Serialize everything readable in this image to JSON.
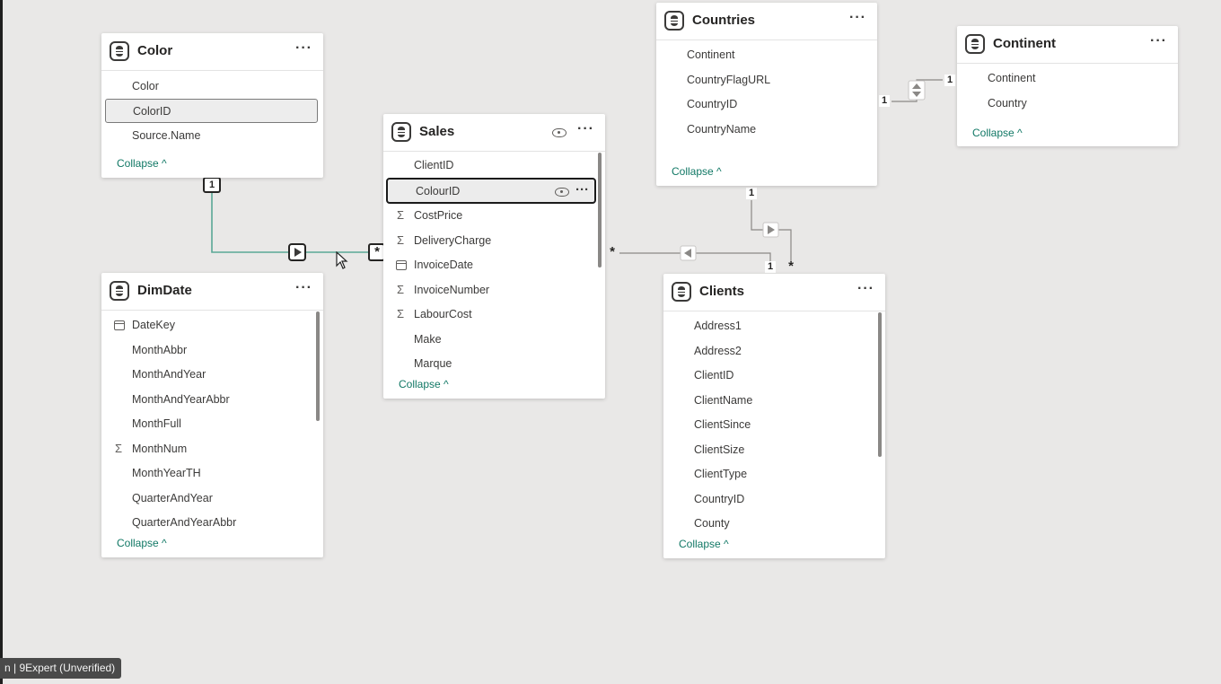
{
  "tables": {
    "color": {
      "title": "Color",
      "fields": [
        "Color",
        "ColorID",
        "Source.Name"
      ],
      "collapse": "Collapse"
    },
    "sales": {
      "title": "Sales",
      "fields": [
        "ClientID",
        "ColourID",
        "CostPrice",
        "DeliveryCharge",
        "InvoiceDate",
        "InvoiceNumber",
        "LabourCost",
        "Make",
        "Marque"
      ],
      "collapse": "Collapse"
    },
    "dimdate": {
      "title": "DimDate",
      "fields": [
        "DateKey",
        "MonthAbbr",
        "MonthAndYear",
        "MonthAndYearAbbr",
        "MonthFull",
        "MonthNum",
        "MonthYearTH",
        "QuarterAndYear",
        "QuarterAndYearAbbr"
      ],
      "collapse": "Collapse"
    },
    "countries": {
      "title": "Countries",
      "fields": [
        "Continent",
        "CountryFlagURL",
        "CountryID",
        "CountryName"
      ],
      "collapse": "Collapse"
    },
    "continent": {
      "title": "Continent",
      "fields": [
        "Continent",
        "Country"
      ],
      "collapse": "Collapse"
    },
    "clients": {
      "title": "Clients",
      "fields": [
        "Address1",
        "Address2",
        "ClientID",
        "ClientName",
        "ClientSince",
        "ClientSize",
        "ClientType",
        "CountryID",
        "County"
      ],
      "collapse": "Collapse"
    }
  },
  "cardinality": {
    "one": "1",
    "many": "*"
  },
  "more_glyph": "···",
  "collapse_glyph": "^",
  "sigma_glyph": "Σ",
  "watermark": "n | 9Expert (Unverified)",
  "colors": {
    "canvas": "#e9e8e7",
    "accent": "#117865",
    "line": "#7a7a7a"
  }
}
